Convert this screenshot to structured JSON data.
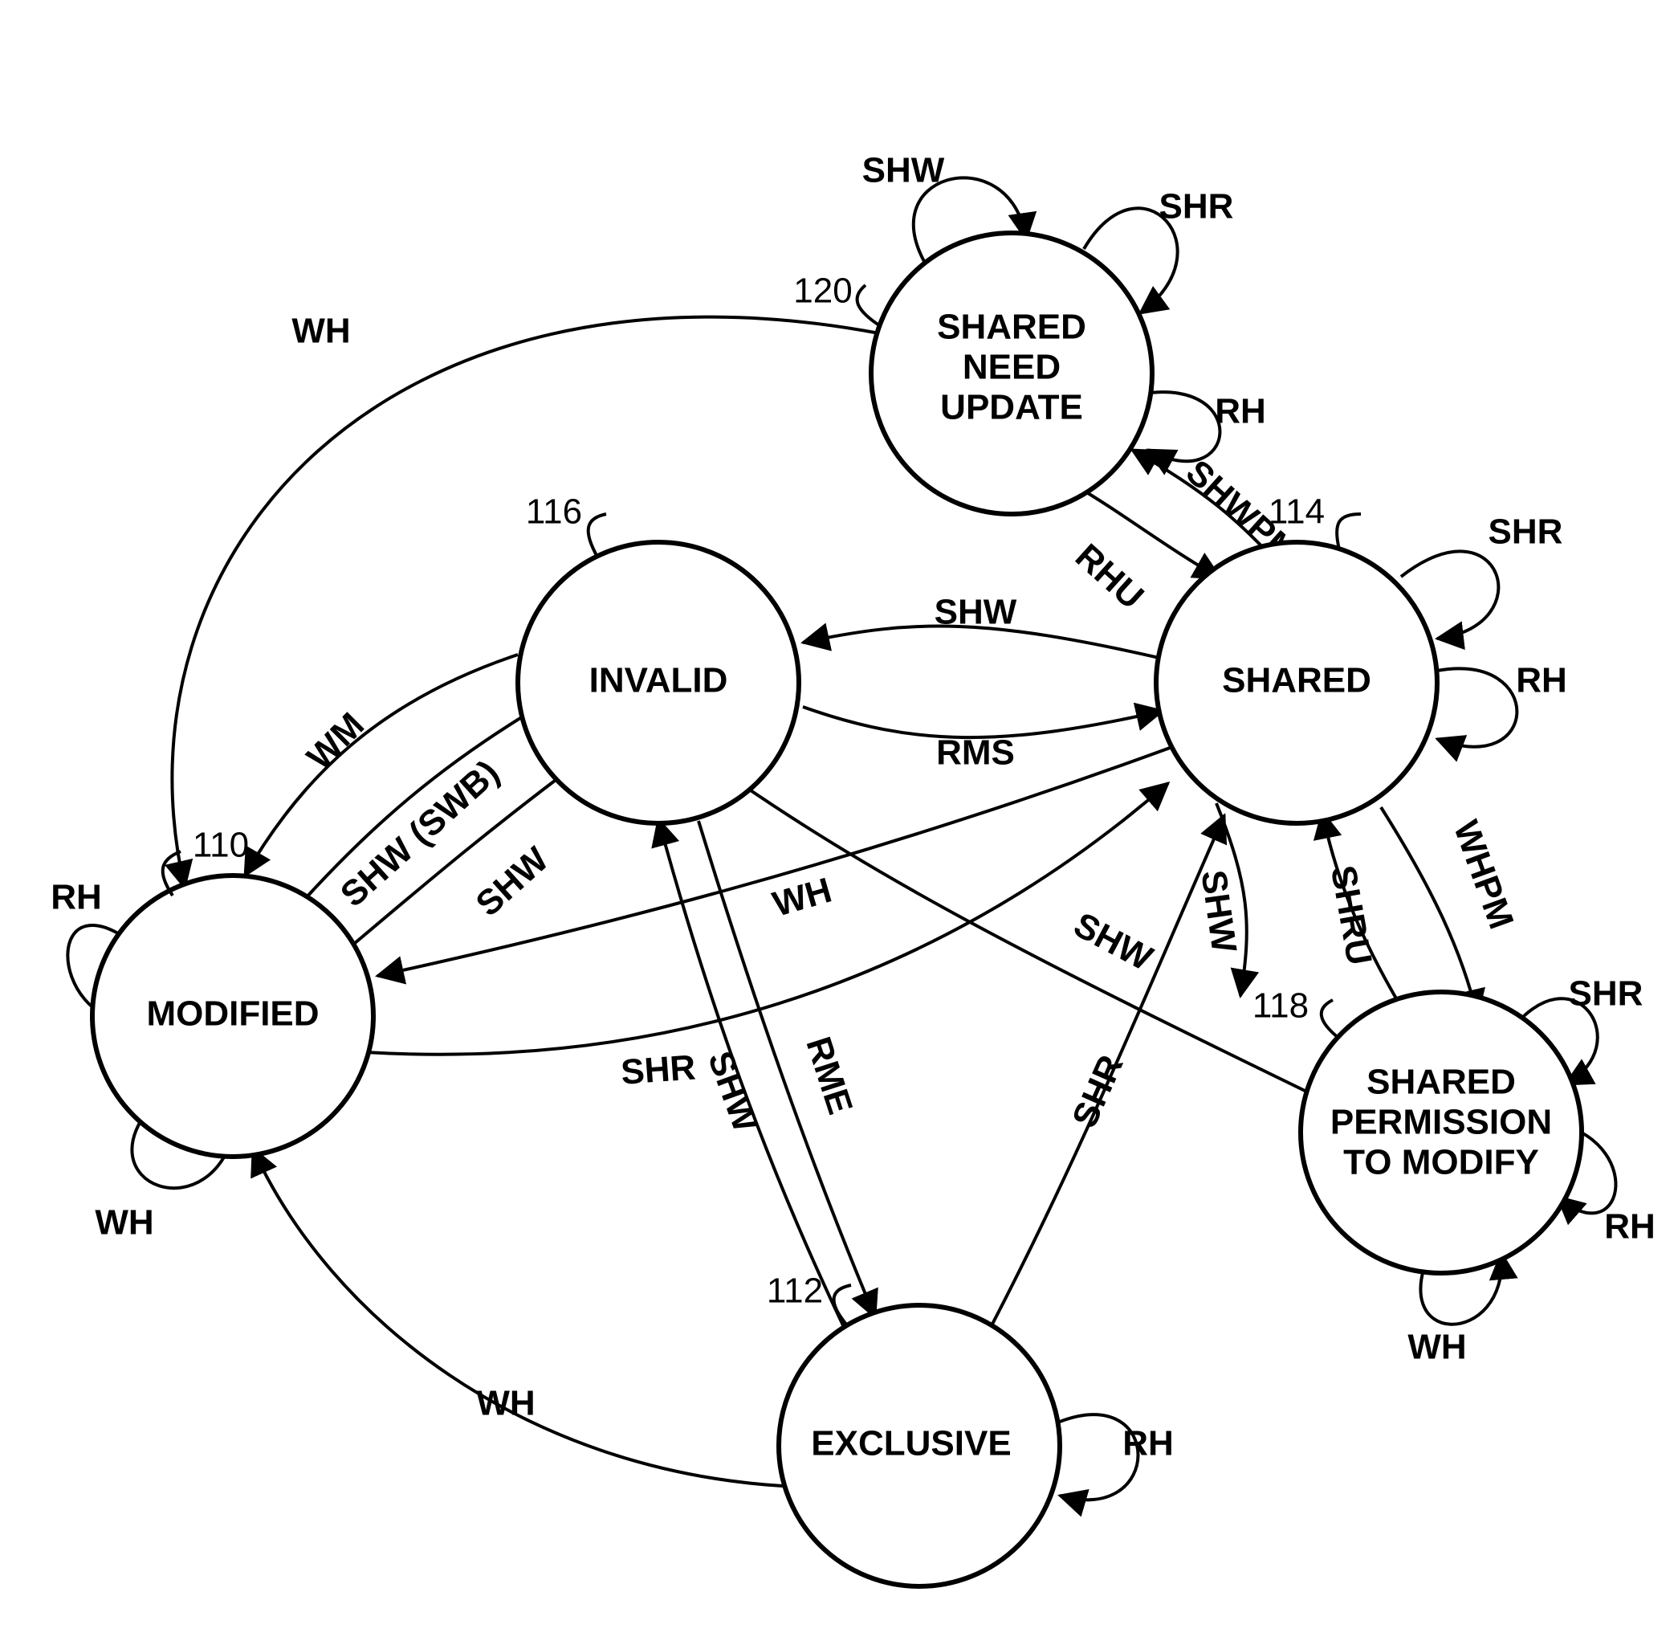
{
  "diagram_type": "state-machine",
  "states": {
    "modified": {
      "id": "110",
      "label": [
        "MODIFIED"
      ],
      "ref": "110"
    },
    "exclusive": {
      "id": "112",
      "label": [
        "EXCLUSIVE"
      ],
      "ref": "112"
    },
    "shared": {
      "id": "114",
      "label": [
        "SHARED"
      ],
      "ref": "114"
    },
    "invalid": {
      "id": "116",
      "label": [
        "INVALID"
      ],
      "ref": "116"
    },
    "sharedPM": {
      "id": "118",
      "label": [
        "SHARED",
        "PERMISSION",
        "TO MODIFY"
      ],
      "ref": "118"
    },
    "sharedNU": {
      "id": "120",
      "label": [
        "SHARED",
        "NEED",
        "UPDATE"
      ],
      "ref": "120"
    }
  },
  "transitions": [
    {
      "from": "modified",
      "to": "modified",
      "label": "RH"
    },
    {
      "from": "modified",
      "to": "modified",
      "label": "WH"
    },
    {
      "from": "exclusive",
      "to": "exclusive",
      "label": "RH"
    },
    {
      "from": "shared",
      "to": "shared",
      "label": "RH"
    },
    {
      "from": "shared",
      "to": "shared",
      "label": "SHR"
    },
    {
      "from": "sharedPM",
      "to": "sharedPM",
      "label": "RH"
    },
    {
      "from": "sharedPM",
      "to": "sharedPM",
      "label": "WH"
    },
    {
      "from": "sharedPM",
      "to": "sharedPM",
      "label": "SHR"
    },
    {
      "from": "sharedNU",
      "to": "sharedNU",
      "label": "RH"
    },
    {
      "from": "sharedNU",
      "to": "sharedNU",
      "label": "SHR"
    },
    {
      "from": "sharedNU",
      "to": "sharedNU",
      "label": "SHW"
    },
    {
      "from": "sharedNU",
      "to": "modified",
      "label": "WH"
    },
    {
      "from": "sharedNU",
      "to": "shared",
      "label": "RHU"
    },
    {
      "from": "shared",
      "to": "sharedNU",
      "label": "SHWPM"
    },
    {
      "from": "shared",
      "to": "sharedPM",
      "label": "WHPM"
    },
    {
      "from": "sharedPM",
      "to": "shared",
      "label": "SHRU"
    },
    {
      "from": "sharedPM",
      "to": "invalid",
      "label": "SHW"
    },
    {
      "from": "shared",
      "to": "invalid",
      "label": "SHW"
    },
    {
      "from": "invalid",
      "to": "shared",
      "label": "RMS"
    },
    {
      "from": "shared",
      "to": "modified",
      "label": "WH"
    },
    {
      "from": "modified",
      "to": "shared",
      "label": "SHR"
    },
    {
      "from": "modified",
      "to": "invalid",
      "label": "SHW (SWB)"
    },
    {
      "from": "invalid",
      "to": "modified",
      "label": "WM"
    },
    {
      "from": "invalid",
      "to": "exclusive",
      "label": "RME"
    },
    {
      "from": "exclusive",
      "to": "modified",
      "label": "WH"
    },
    {
      "from": "exclusive",
      "to": "shared",
      "label": "SHR"
    },
    {
      "from": "exclusive",
      "to": "invalid",
      "label": "SHW"
    },
    {
      "from": "sharedPM",
      "to": "modified",
      "label": "SHW"
    }
  ],
  "legend_symbols": [
    "RH",
    "WH",
    "SHR",
    "SHW",
    "RMS",
    "RME",
    "WM",
    "SHRU",
    "SHWPM",
    "WHPM",
    "RHU",
    "SWB"
  ]
}
